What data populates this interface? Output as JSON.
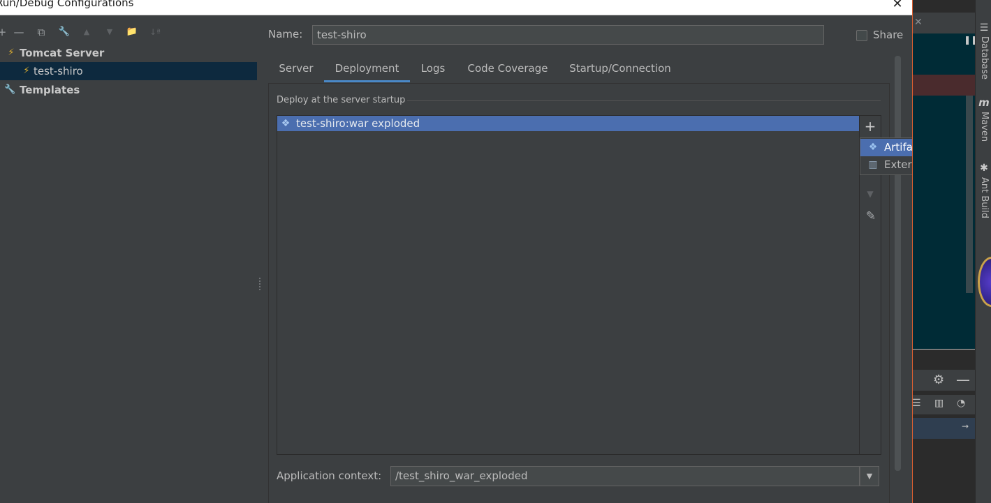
{
  "window": {
    "title": "Run/Debug Configurations",
    "close_glyph": "✕"
  },
  "toolbar": {
    "buttons": [
      {
        "name": "add-icon",
        "glyph": "+"
      },
      {
        "name": "remove-icon",
        "glyph": "—"
      },
      {
        "name": "copy-icon",
        "glyph": "⧉"
      },
      {
        "name": "wrench-icon",
        "glyph": "🔧"
      },
      {
        "name": "move-up-icon",
        "glyph": "▲"
      },
      {
        "name": "move-down-icon",
        "glyph": "▼"
      },
      {
        "name": "folder-icon",
        "glyph": "📁"
      },
      {
        "name": "sort-icon",
        "glyph": "↓ª"
      }
    ]
  },
  "tree": {
    "tomcat": {
      "label": "Tomcat Server",
      "icon": "tomcat-icon",
      "glyph": "⚡"
    },
    "config": {
      "label": "test-shiro",
      "icon": "tomcat-icon",
      "glyph": "⚡"
    },
    "templates": {
      "label": "Templates",
      "icon": "wrench-icon",
      "glyph": "🔧"
    }
  },
  "form": {
    "name_label": "Name:",
    "name_value": "test-shiro",
    "share_label": "Share",
    "share_checked": false
  },
  "tabs": [
    {
      "label": "Server",
      "active": false
    },
    {
      "label": "Deployment",
      "active": true
    },
    {
      "label": "Logs",
      "active": false
    },
    {
      "label": "Code Coverage",
      "active": false
    },
    {
      "label": "Startup/Connection",
      "active": false
    }
  ],
  "deployment": {
    "group_label": "Deploy at the server startup",
    "items": [
      {
        "label": "test-shiro:war exploded",
        "icon": "artifact-icon",
        "selected": true
      }
    ],
    "add_glyph": "+",
    "down_glyph": "▼",
    "edit_glyph": "✎",
    "context_label": "Application context:",
    "context_value": "/test_shiro_war_exploded",
    "dropdown_glyph": "▼"
  },
  "popup_menu": [
    {
      "label": "Artifact...",
      "icon": "artifact-icon",
      "glyph": "❖",
      "highlighted": true
    },
    {
      "label": "External Source...",
      "icon": "archive-icon",
      "glyph": "▥",
      "highlighted": false
    }
  ],
  "side_bar": {
    "database": "Database",
    "maven": "Maven",
    "ant": "Ant Build",
    "maven_glyph": "m"
  },
  "colors": {
    "background": "#3c3f41",
    "selection": "#4b6eaf",
    "tree_selection": "#0d293e",
    "active_tab": "#4a88c7"
  }
}
